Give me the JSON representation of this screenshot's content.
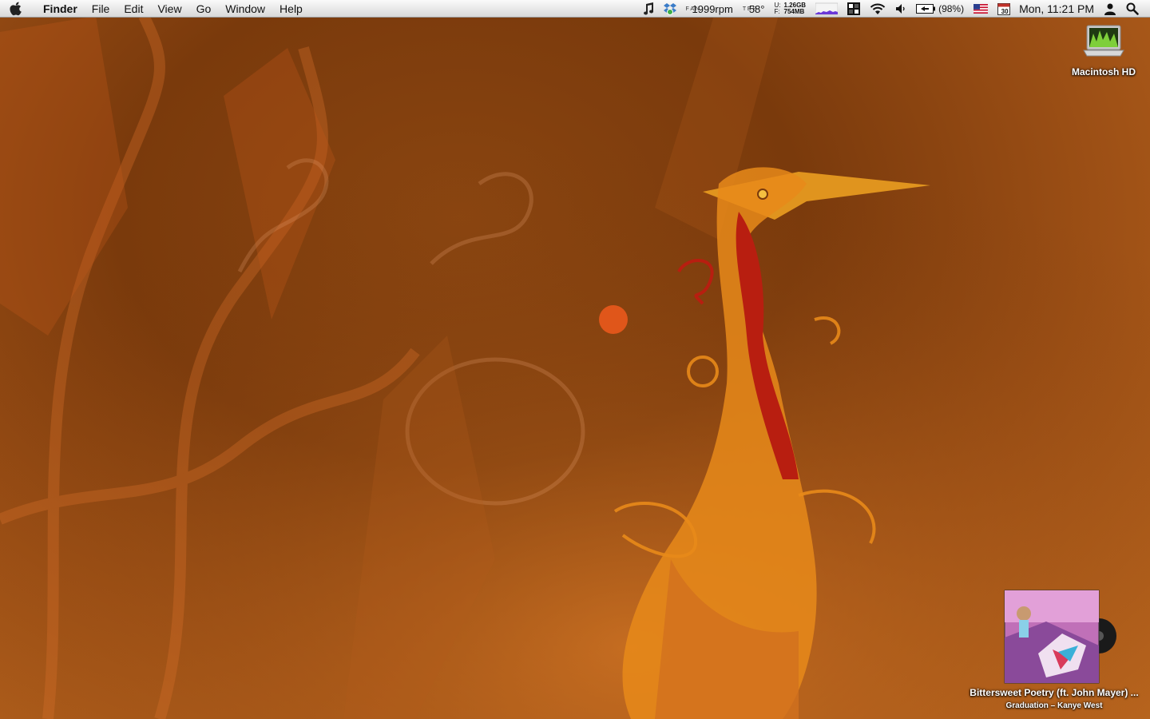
{
  "menubar": {
    "app_name": "Finder",
    "menus": [
      "File",
      "Edit",
      "View",
      "Go",
      "Window",
      "Help"
    ],
    "status": {
      "fan_label": "F A N",
      "fan_speed": "1999rpm",
      "temp_label": "T E P",
      "temperature": "58°",
      "disk_u_label": "U:",
      "disk_f_label": "F:",
      "disk_used": "1.26GB",
      "disk_free": "754MB",
      "battery": "(98%)",
      "calendar_day": "30",
      "clock": "Mon, 11:21 PM"
    },
    "icons": [
      "apple-icon",
      "itunes-note-icon",
      "dropbox-icon",
      "activity-graph-icon",
      "spaces-icon",
      "wifi-icon",
      "volume-icon",
      "battery-icon",
      "flag-icon",
      "calendar-icon",
      "user-icon",
      "spotlight-icon"
    ]
  },
  "desktop": {
    "drive_label": "Macintosh HD"
  },
  "now_playing": {
    "title": "Bittersweet Poetry (ft. John Mayer) ...",
    "subtitle": "Graduation – Kanye West"
  },
  "colors": {
    "wallpaper_base": "#7a3a0c",
    "accent_orange": "#e88a1a",
    "accent_red": "#b81e10"
  }
}
